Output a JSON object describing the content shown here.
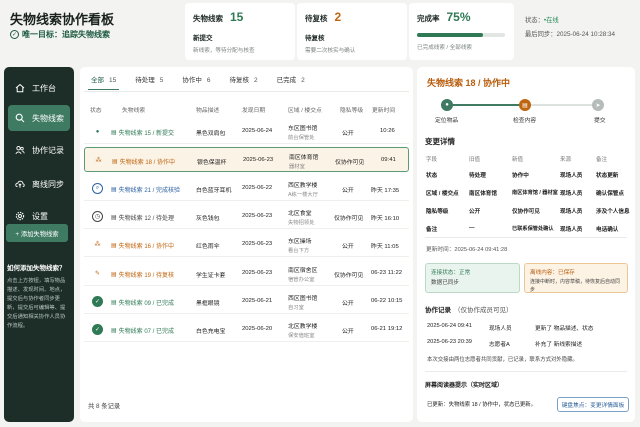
{
  "header": {
    "title": "失物线索协作看板",
    "goal": "唯一目标：追踪失物线索"
  },
  "stats": [
    {
      "title": "失物线索",
      "value": "15",
      "sub": "新提交",
      "desc": "新线索，等待分配与核查"
    },
    {
      "title": "待复核",
      "value": "2",
      "sub": "待复核",
      "desc": "需要二次核实与确认"
    },
    {
      "title": "完成率",
      "value": "75%",
      "progress": 0.75,
      "sub": "",
      "desc": "已完成线索 / 全部线索"
    }
  ],
  "status": {
    "state_label": "状态：",
    "state_value": "•在线",
    "sync_label": "最后同步：",
    "sync_value": "2025-06-24 10:28:34"
  },
  "sidebar": {
    "items": [
      {
        "label": "工作台",
        "icon": "home-icon"
      },
      {
        "label": "失物线索",
        "icon": "search-icon"
      },
      {
        "label": "协作记录",
        "icon": "users-icon"
      },
      {
        "label": "离线同步",
        "icon": "cloud-upload-icon"
      },
      {
        "label": "设置",
        "icon": "gear-icon"
      }
    ],
    "add_button": "+ 添加失物线索",
    "help_title": "如何添加失物线索？",
    "help_text": "点击上方按钮，填写物品描述、发现时间、地点，提交后与协作者同步更新，提交后可编辑等、提交后通知相关协作人员协作流程。"
  },
  "tabs": [
    {
      "label": "全部",
      "count": "15"
    },
    {
      "label": "待处理",
      "count": "5"
    },
    {
      "label": "协作中",
      "count": "6"
    },
    {
      "label": "待复核",
      "count": "2"
    },
    {
      "label": "已完成",
      "count": "2"
    }
  ],
  "table": {
    "headers": [
      "状态",
      "失物线索",
      "物品描述",
      "发现日期",
      "区域 / 楼交点",
      "隐私等级",
      "更新时间"
    ],
    "rows": [
      {
        "id": "失物线索 15 / 新提交",
        "desc": "黑色双肩包",
        "date": "2025-06-24",
        "loc": "东区图书馆",
        "loc_sub": "前台保管处",
        "privacy": "公开",
        "time": "10:26",
        "status": "new",
        "color": "#2f7a55"
      },
      {
        "id": "失物线索 18 / 协作中",
        "desc": "银色保温杯",
        "date": "2025-06-23",
        "loc": "南区体育馆",
        "loc_sub": "器材室",
        "privacy": "仅协作可见",
        "time": "09:41",
        "status": "collab",
        "color": "#c0650f"
      },
      {
        "id": "失物线索 21 / 完成核验",
        "desc": "白色蓝牙耳机",
        "date": "2025-06-22",
        "loc": "西区教学楼",
        "loc_sub": "A栋一楼大厅",
        "privacy": "公开",
        "time": "昨天 17:35",
        "status": "verify",
        "color": "#2e62a3"
      },
      {
        "id": "失物线索 12 / 待处理",
        "desc": "灰色钱包",
        "date": "2025-06-23",
        "loc": "北区食堂",
        "loc_sub": "失物招领处",
        "privacy": "仅协作可见",
        "time": "昨天 16:10",
        "status": "pending",
        "color": "#444444"
      },
      {
        "id": "失物线索 16 / 协作中",
        "desc": "红色雨伞",
        "date": "2025-06-23",
        "loc": "东区操场",
        "loc_sub": "看台下方",
        "privacy": "公开",
        "time": "昨天 11:05",
        "status": "collab",
        "color": "#c0650f"
      },
      {
        "id": "失物线索 19 / 待复核",
        "desc": "学生证卡套",
        "date": "2025-06-23",
        "loc": "南区宿舍区",
        "loc_sub": "宿管办公室",
        "privacy": "仅协作可见",
        "time": "06-23 11:22",
        "status": "review",
        "color": "#c0650f"
      },
      {
        "id": "失物线索 09 / 已完成",
        "desc": "黑框眼镜",
        "date": "2025-06-21",
        "loc": "西区图书馆",
        "loc_sub": "自习室",
        "privacy": "公开",
        "time": "06-22 10:15",
        "status": "done",
        "color": "#2f7a55"
      },
      {
        "id": "失物线索 07 / 已完成",
        "desc": "白色充电宝",
        "date": "2025-06-20",
        "loc": "北区教学楼",
        "loc_sub": "保安值班室",
        "privacy": "公开",
        "time": "06-21 19:12",
        "status": "done",
        "color": "#2f7a55"
      }
    ],
    "footer": "共 8 条记录"
  },
  "panel": {
    "title": "失物线索 18 / 协作中",
    "steps": [
      "定位物品",
      "检查内容",
      "提交"
    ],
    "change_title": "变更详情",
    "change_headers": [
      "字段",
      "旧值",
      "新值",
      "来源",
      "备注"
    ],
    "change_rows": [
      [
        "状态",
        "待处理",
        "协作中",
        "现场人员",
        "状态更新"
      ],
      [
        "区域 / 楼交点",
        "南区体育馆",
        "南区体育馆 / 器材室",
        "现场人员",
        "确认保管点"
      ],
      [
        "隐私等级",
        "公开",
        "仅协作可见",
        "现场人员",
        "涉及个人信息"
      ],
      [
        "备注",
        "—",
        "已联系保管处确认",
        "现场人员",
        "电话确认"
      ]
    ],
    "updated": "更新时间：2025-06-24 09:41:28",
    "online_title": "连接状态：",
    "online_value": "正常",
    "online_desc": "数据已同步",
    "offline_title": "离线内容：",
    "offline_value": "已保存",
    "offline_desc": "连接中断时，内容草稿，待恢复后自动同步",
    "log_title": "协作记录",
    "log_subtitle": "（仅协作成员可见）",
    "logs": [
      {
        "time": "2025-06-24 09:41",
        "who": "现场人员",
        "what": "更新了 物品描述、状态"
      },
      {
        "time": "2025-06-23 20:39",
        "who": "志愿者A",
        "what": "补充了 新线索描述"
      }
    ],
    "log_note": "本次交接由两位志愿者共同贡献，已记录，联系方式对外隐藏。",
    "reader_title": "屏幕阅读器提示（实时区域）",
    "reader_text": "已更新：失物线索 18 / 协作中，状态已更新。",
    "reader_button": "键盘焦点：变更详情面板"
  }
}
